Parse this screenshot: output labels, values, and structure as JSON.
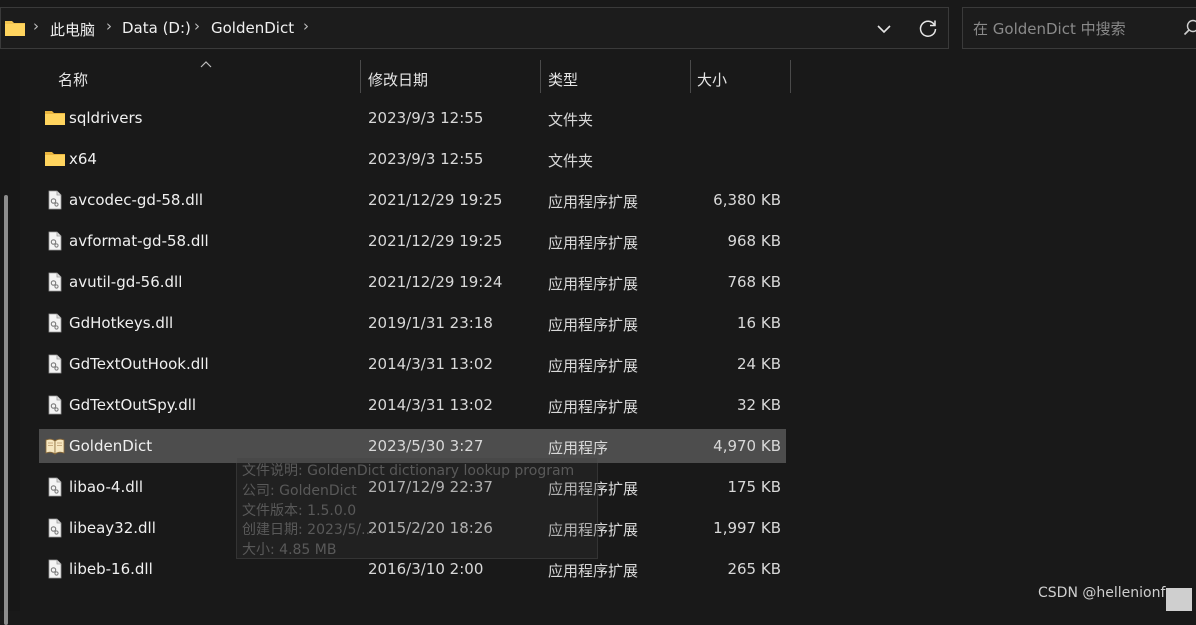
{
  "address": {
    "crumbs": [
      "此电脑",
      "Data (D:)",
      "GoldenDict"
    ],
    "separator": "›"
  },
  "search": {
    "placeholder": "在 GoldenDict 中搜索"
  },
  "columns": {
    "name": "名称",
    "date": "修改日期",
    "type": "类型",
    "size": "大小"
  },
  "files": [
    {
      "name": "sqldrivers",
      "date": "2023/9/3 12:55",
      "type": "文件夹",
      "size": "",
      "icon": "folder-icon"
    },
    {
      "name": "x64",
      "date": "2023/9/3 12:55",
      "type": "文件夹",
      "size": "",
      "icon": "folder-icon"
    },
    {
      "name": "avcodec-gd-58.dll",
      "date": "2021/12/29 19:25",
      "type": "应用程序扩展",
      "size": "6,380 KB",
      "icon": "dll-file-icon"
    },
    {
      "name": "avformat-gd-58.dll",
      "date": "2021/12/29 19:25",
      "type": "应用程序扩展",
      "size": "968 KB",
      "icon": "dll-file-icon"
    },
    {
      "name": "avutil-gd-56.dll",
      "date": "2021/12/29 19:24",
      "type": "应用程序扩展",
      "size": "768 KB",
      "icon": "dll-file-icon"
    },
    {
      "name": "GdHotkeys.dll",
      "date": "2019/1/31 23:18",
      "type": "应用程序扩展",
      "size": "16 KB",
      "icon": "dll-file-icon"
    },
    {
      "name": "GdTextOutHook.dll",
      "date": "2014/3/31 13:02",
      "type": "应用程序扩展",
      "size": "24 KB",
      "icon": "dll-file-icon"
    },
    {
      "name": "GdTextOutSpy.dll",
      "date": "2014/3/31 13:02",
      "type": "应用程序扩展",
      "size": "32 KB",
      "icon": "dll-file-icon"
    },
    {
      "name": "GoldenDict",
      "date": "2023/5/30 3:27",
      "type": "应用程序",
      "size": "4,970 KB",
      "icon": "book-app-icon",
      "selected": true
    },
    {
      "name": "libao-4.dll",
      "date": "2017/12/9 22:37",
      "type": "应用程序扩展",
      "size": "175 KB",
      "icon": "dll-file-icon"
    },
    {
      "name": "libeay32.dll",
      "date": "2015/2/20 18:26",
      "type": "应用程序扩展",
      "size": "1,997 KB",
      "icon": "dll-file-icon"
    },
    {
      "name": "libeb-16.dll",
      "date": "2016/3/10 2:00",
      "type": "应用程序扩展",
      "size": "265 KB",
      "icon": "dll-file-icon"
    }
  ],
  "tooltip": {
    "lines": [
      "文件说明: GoldenDict dictionary lookup program",
      "公司: GoldenDict",
      "文件版本: 1.5.0.0",
      "创建日期: 2023/5/...",
      "大小: 4.85 MB"
    ]
  },
  "watermark": "CSDN @hellenionfa",
  "colors": {
    "background": "#191919",
    "selected_row": "#4d4d4d",
    "folder": "#f2c450"
  }
}
